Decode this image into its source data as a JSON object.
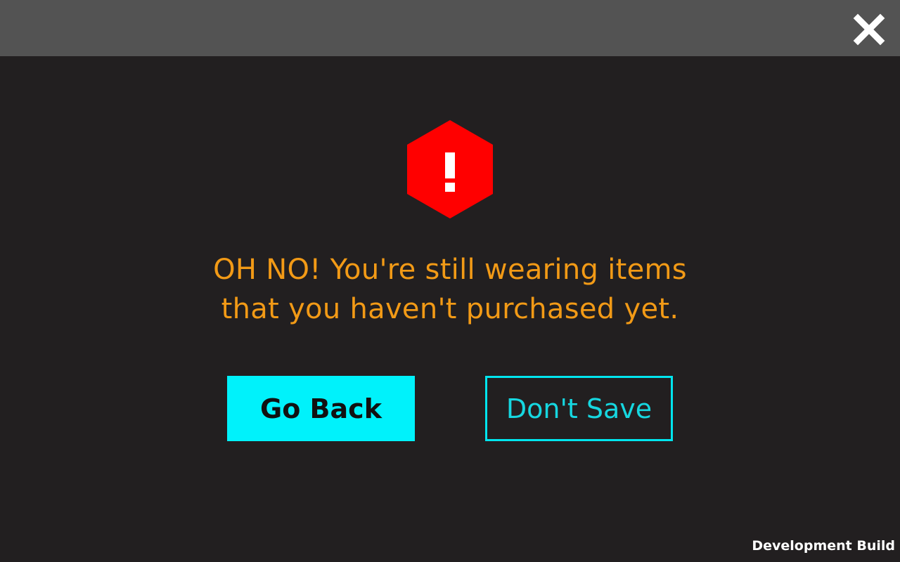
{
  "top_bar": {
    "close_icon": "close-icon",
    "close_icon_color": "#ffffff",
    "background_color": "#535353"
  },
  "dialog": {
    "warning_icon": "warning-hexagon-icon",
    "warning_icon_color": "#ff0000",
    "message_lines": [
      "OH NO! You're still wearing items",
      "that you haven't purchased yet."
    ],
    "message_color": "#f29a16",
    "buttons": {
      "go_back_label": "Go Back",
      "dont_save_label": "Don't Save"
    },
    "accent_color": "#00f2fb",
    "background_color": "#221f20"
  },
  "footer": {
    "build_label": "Development Build"
  }
}
